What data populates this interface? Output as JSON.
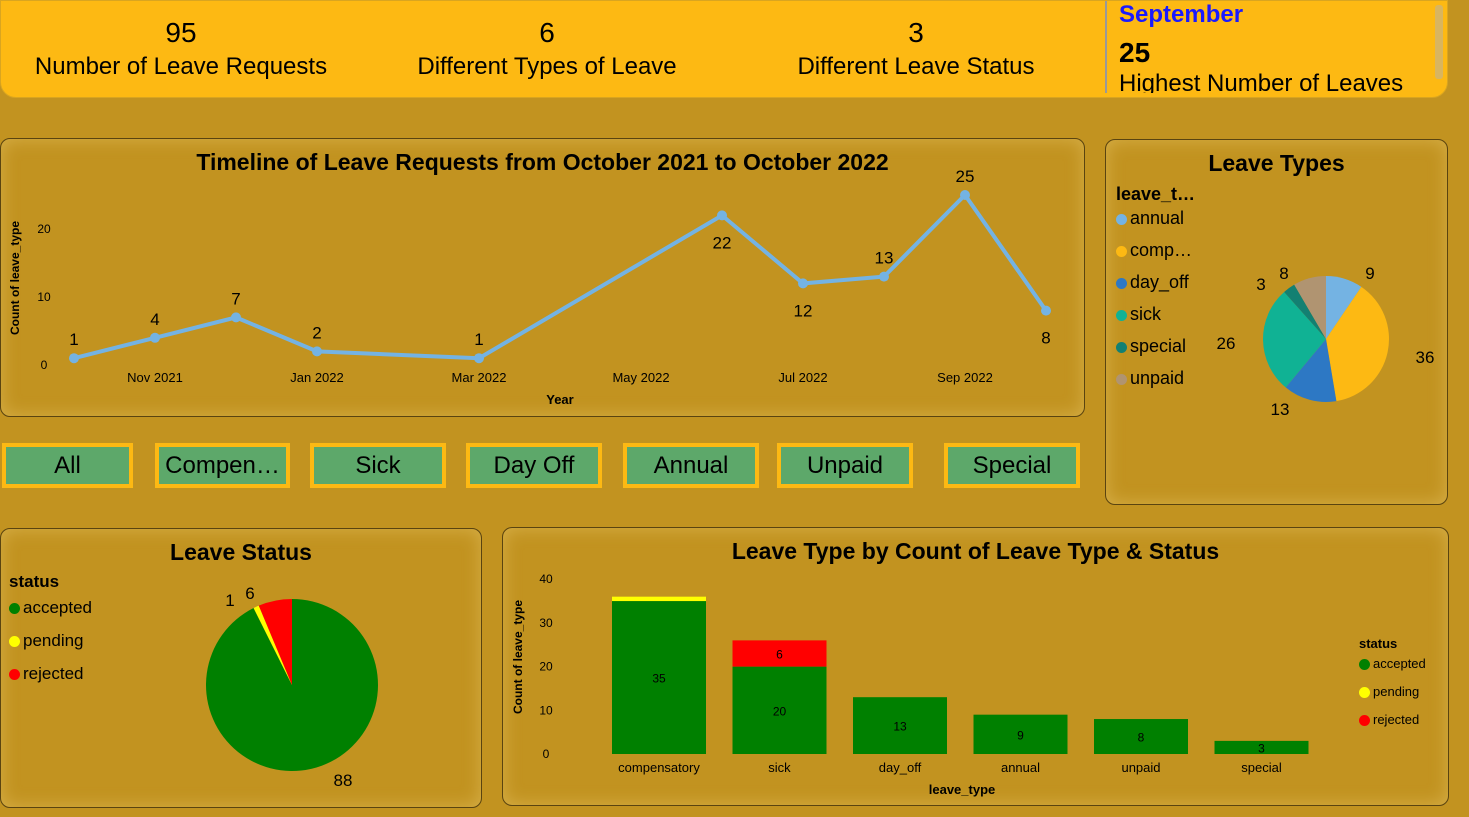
{
  "kpis": [
    {
      "value": "95",
      "label": "Number of Leave Requests"
    },
    {
      "value": "6",
      "label": "Different Types of Leave"
    },
    {
      "value": "3",
      "label": "Different Leave Status"
    }
  ],
  "highest": {
    "month": "September",
    "value": "25",
    "label": "Highest Number of Leaves"
  },
  "buttons": [
    "All",
    "Compen…",
    "Sick",
    "Day Off",
    "Annual",
    "Unpaid",
    "Special"
  ],
  "colors": {
    "bg": "#C29320",
    "banner": "#FDB913",
    "line": "#74B3E3",
    "month": "#1a1aff"
  },
  "chart_data": [
    {
      "type": "line",
      "title": "Timeline of Leave Requests from October 2021 to October 2022",
      "xlabel": "Year",
      "ylabel": "Count of leave_type",
      "x": [
        "Oct 2021",
        "Nov 2021",
        "Dec 2021",
        "Jan 2022",
        "Mar 2022",
        "Jun 2022",
        "Jul 2022",
        "Aug 2022",
        "Sep 2022",
        "Oct 2022"
      ],
      "xi": [
        0,
        1,
        2,
        3,
        5,
        8,
        9,
        10,
        11,
        12
      ],
      "values": [
        1,
        4,
        7,
        2,
        1,
        22,
        12,
        13,
        25,
        8
      ],
      "xticks": [
        {
          "i": 1,
          "label": "Nov 2021"
        },
        {
          "i": 3,
          "label": "Jan 2022"
        },
        {
          "i": 5,
          "label": "Mar 2022"
        },
        {
          "i": 7,
          "label": "May 2022"
        },
        {
          "i": 9,
          "label": "Jul 2022"
        },
        {
          "i": 11,
          "label": "Sep 2022"
        }
      ],
      "yticks": [
        0,
        10,
        20
      ],
      "ylim": [
        0,
        26
      ]
    },
    {
      "type": "pie",
      "title": "Leave Types",
      "legend_title": "leave_t…",
      "slices": [
        {
          "label": "annual",
          "value": 9,
          "color": "#74B3E3"
        },
        {
          "label": "comp…",
          "value": 36,
          "color": "#FDB913"
        },
        {
          "label": "day_off",
          "value": 13,
          "color": "#2D78C4"
        },
        {
          "label": "sick",
          "value": 26,
          "color": "#10B294"
        },
        {
          "label": "special",
          "value": 3,
          "color": "#138072"
        },
        {
          "label": "unpaid",
          "value": 8,
          "color": "#B09471"
        }
      ]
    },
    {
      "type": "pie",
      "title": "Leave Status",
      "legend_title": "status",
      "slices": [
        {
          "label": "accepted",
          "value": 88,
          "color": "#008000"
        },
        {
          "label": "pending",
          "value": 1,
          "color": "#FFFF00"
        },
        {
          "label": "rejected",
          "value": 6,
          "color": "#FF0000"
        }
      ]
    },
    {
      "type": "bar",
      "stacked": true,
      "title": "Leave Type by Count of Leave Type & Status",
      "xlabel": "leave_type",
      "ylabel": "Count of leave_type",
      "legend_title": "status",
      "categories": [
        "compensatory",
        "sick",
        "day_off",
        "annual",
        "unpaid",
        "special"
      ],
      "series": [
        {
          "name": "accepted",
          "color": "#008000",
          "values": [
            35,
            20,
            13,
            9,
            8,
            3
          ]
        },
        {
          "name": "pending",
          "color": "#FFFF00",
          "values": [
            1,
            0,
            0,
            0,
            0,
            0
          ]
        },
        {
          "name": "rejected",
          "color": "#FF0000",
          "values": [
            0,
            6,
            0,
            0,
            0,
            0
          ]
        }
      ],
      "yticks": [
        0,
        10,
        20,
        30,
        40
      ],
      "ylim": [
        0,
        40
      ]
    }
  ]
}
